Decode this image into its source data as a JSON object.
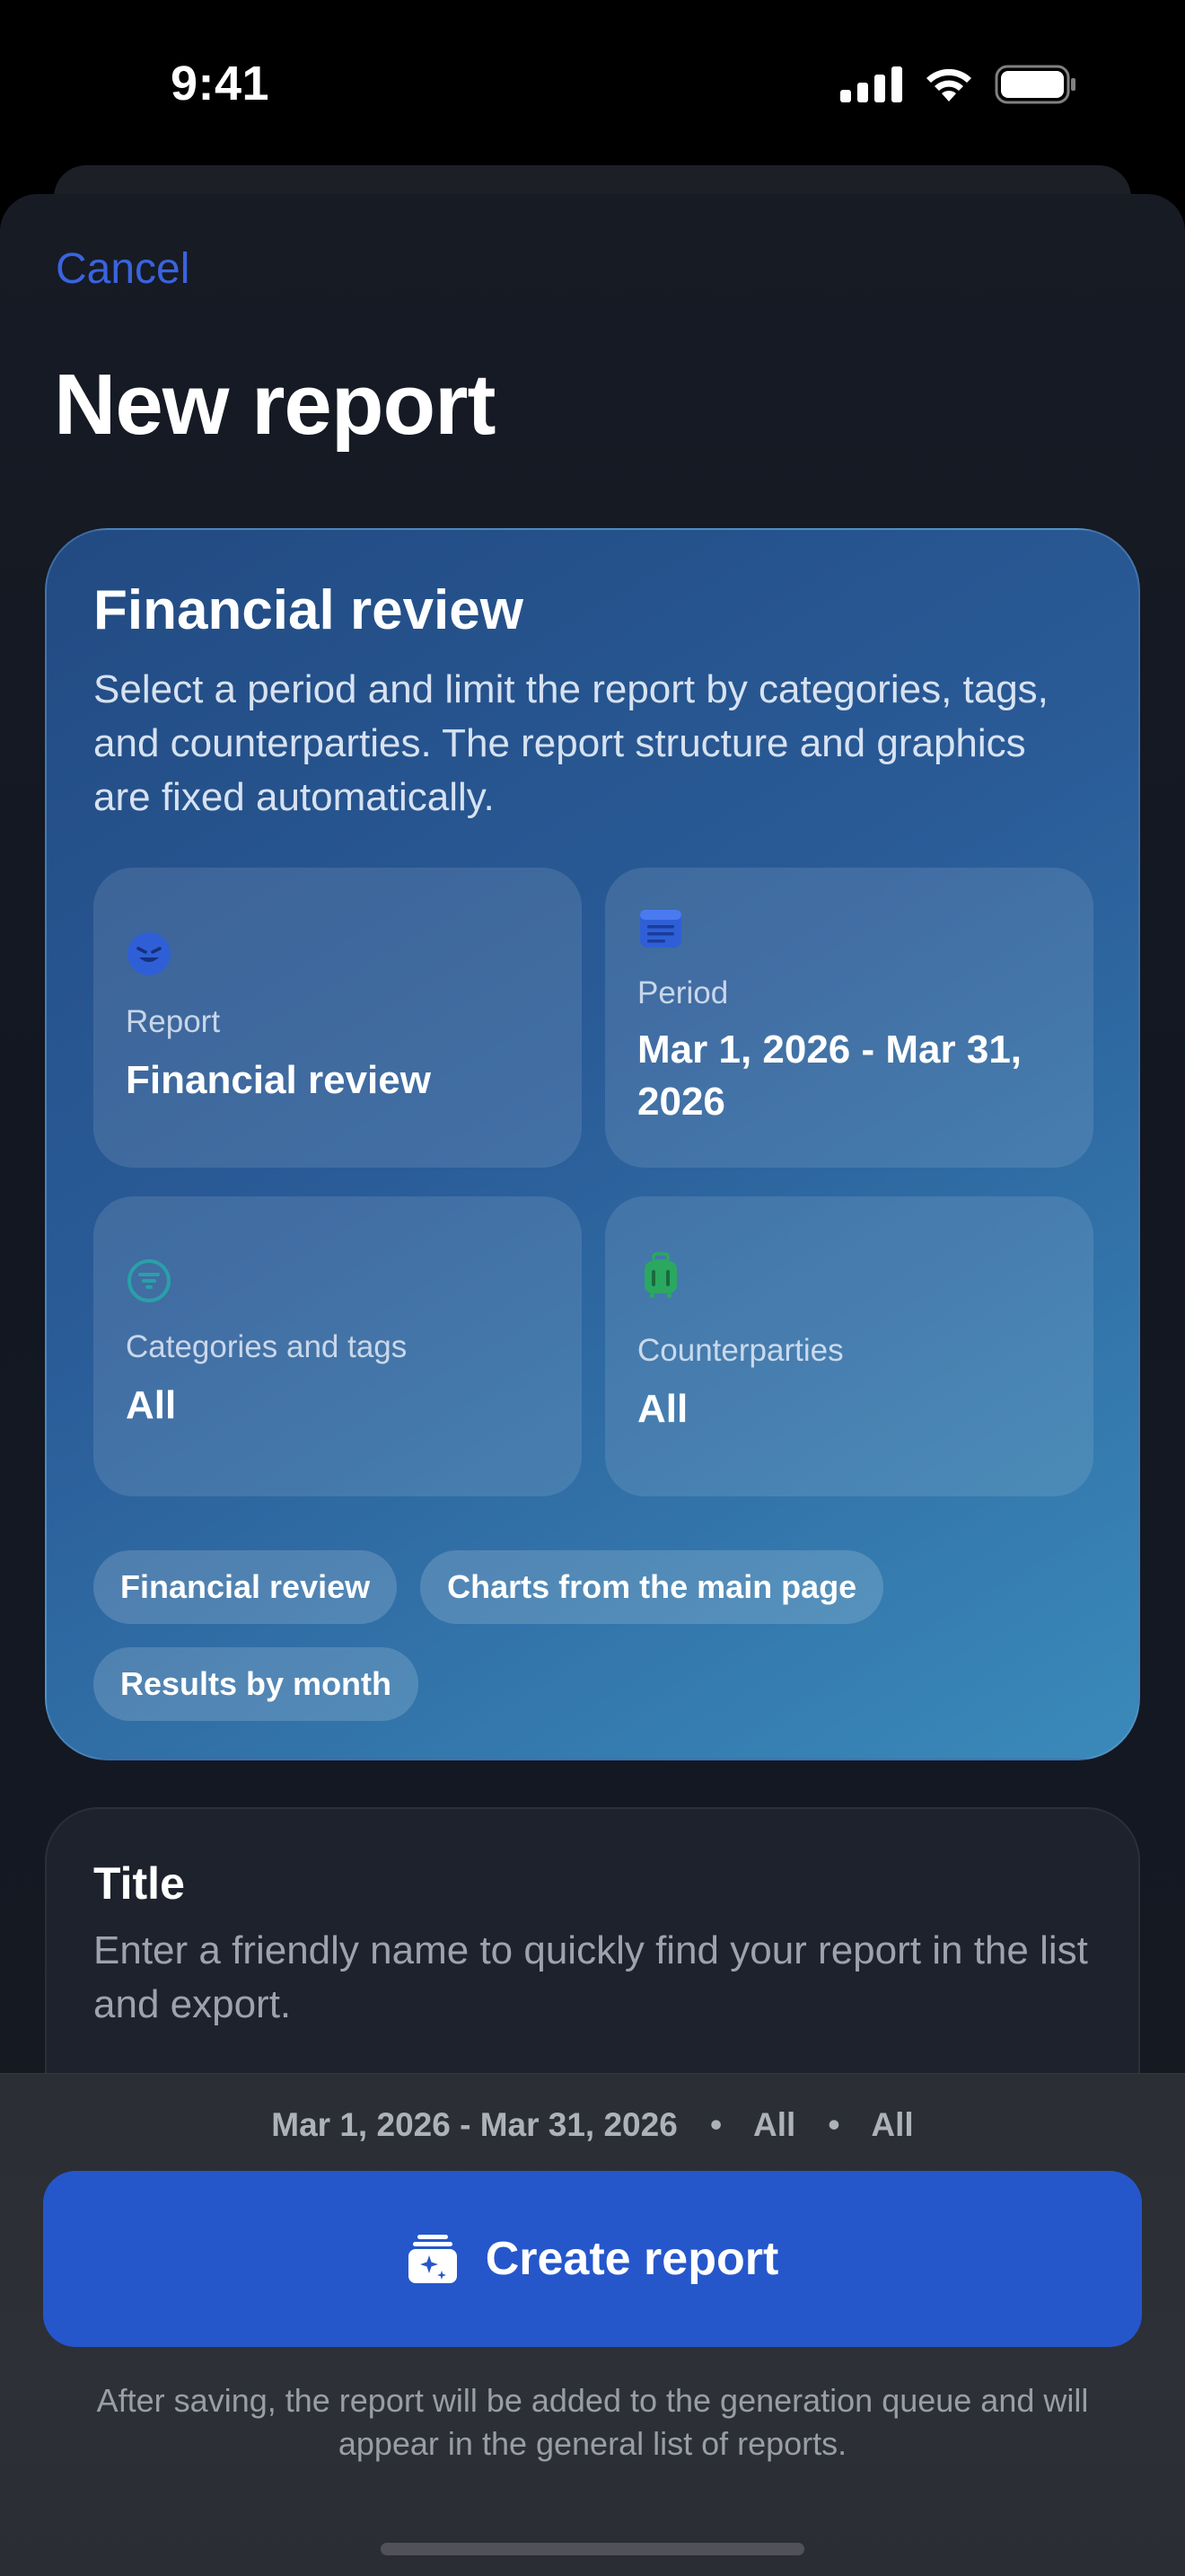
{
  "status_bar": {
    "time": "9:41"
  },
  "header": {
    "cancel_label": "Cancel",
    "title": "New report"
  },
  "financial_card": {
    "title": "Financial review",
    "description": "Select a period and limit the report by categories, tags, and counterparties. The report structure and graphics are fixed automatically.",
    "tiles": [
      {
        "label": "Report",
        "value": "Financial review",
        "icon": "report-face-icon",
        "icon_color": "#2f5fd6"
      },
      {
        "label": "Period",
        "value": "Mar 1, 2026 - Mar 31, 2026",
        "icon": "calendar-icon",
        "icon_color": "#2f5fd6"
      },
      {
        "label": "Categories and tags",
        "value": "All",
        "icon": "filter-icon",
        "icon_color": "#2aa0a8"
      },
      {
        "label": "Counterparties",
        "value": "All",
        "icon": "luggage-icon",
        "icon_color": "#2aa860"
      }
    ],
    "chips": [
      "Financial review",
      "Charts from the main page",
      "Results by month"
    ]
  },
  "title_card": {
    "heading": "Title",
    "description": "Enter a friendly name to quickly find your report in the list and export.",
    "input_value": ""
  },
  "bottom_bar": {
    "summary_period": "Mar 1, 2026 - Mar 31, 2026",
    "summary_separator": "•",
    "summary_categories": "All",
    "summary_counterparties": "All",
    "create_label": "Create report",
    "footnote": "After saving, the report will be added to the generation queue and will appear in the general list of reports."
  },
  "colors": {
    "accent": "#2557cb",
    "link": "#3a63dd"
  }
}
